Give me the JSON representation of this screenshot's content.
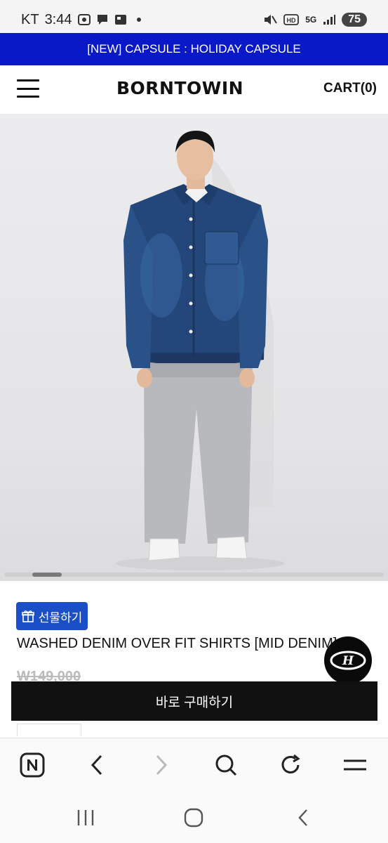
{
  "status_bar": {
    "carrier": "KT",
    "time": "3:44",
    "network": "5G",
    "battery": "75",
    "icons": [
      "screenshot-icon",
      "chat-icon",
      "news-icon",
      "dot-icon",
      "mute-icon",
      "hd-icon",
      "signal-icon"
    ]
  },
  "banner": {
    "text": "[NEW] CAPSULE : HOLIDAY CAPSULE"
  },
  "header": {
    "logo": "BORNTOWIN",
    "cart": "CART(0)"
  },
  "product": {
    "gift_label": "선물하기",
    "title": "WASHED DENIM OVER FIT SHIRTS [MID DENIM]",
    "price": "W149,000",
    "image_slider_position": 0.05
  },
  "buy_button": {
    "label": "바로 구매하기"
  },
  "browser_bar": {
    "icons": [
      "naver-icon",
      "back-icon",
      "forward-icon",
      "search-icon",
      "refresh-icon",
      "menu-icon"
    ]
  },
  "system_nav": {
    "icons": [
      "recents-icon",
      "home-icon",
      "back-icon"
    ]
  },
  "colors": {
    "banner": "#0a19c8",
    "gift": "#1a4fc8",
    "buy": "#111111"
  }
}
